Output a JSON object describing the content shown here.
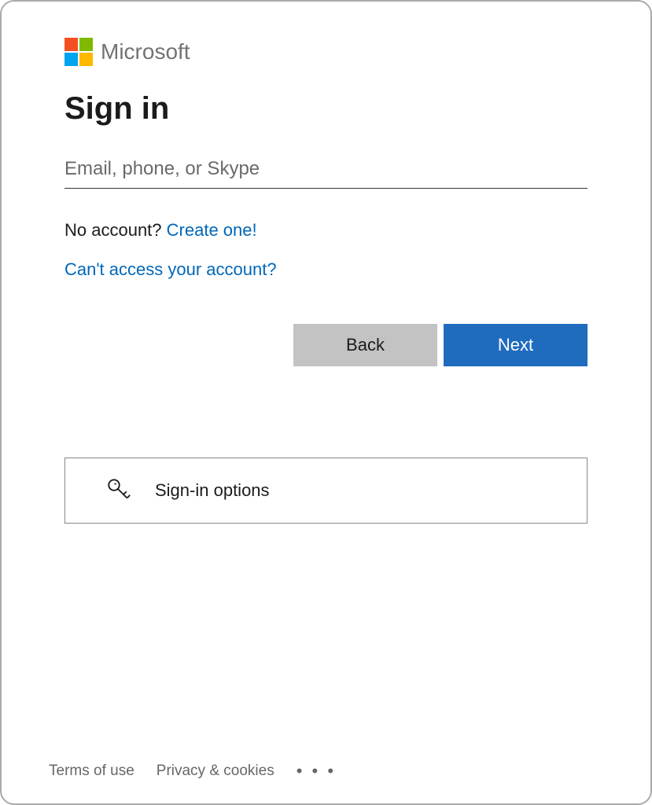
{
  "brand": "Microsoft",
  "title": "Sign in",
  "login_input": {
    "placeholder": "Email, phone, or Skype",
    "value": ""
  },
  "no_account_text": "No account? ",
  "create_one_link": "Create one!",
  "cant_access_link": "Can't access your account?",
  "buttons": {
    "back": "Back",
    "next": "Next"
  },
  "signin_options_label": "Sign-in options",
  "footer": {
    "terms": "Terms of use",
    "privacy": "Privacy & cookies",
    "more": "..."
  }
}
